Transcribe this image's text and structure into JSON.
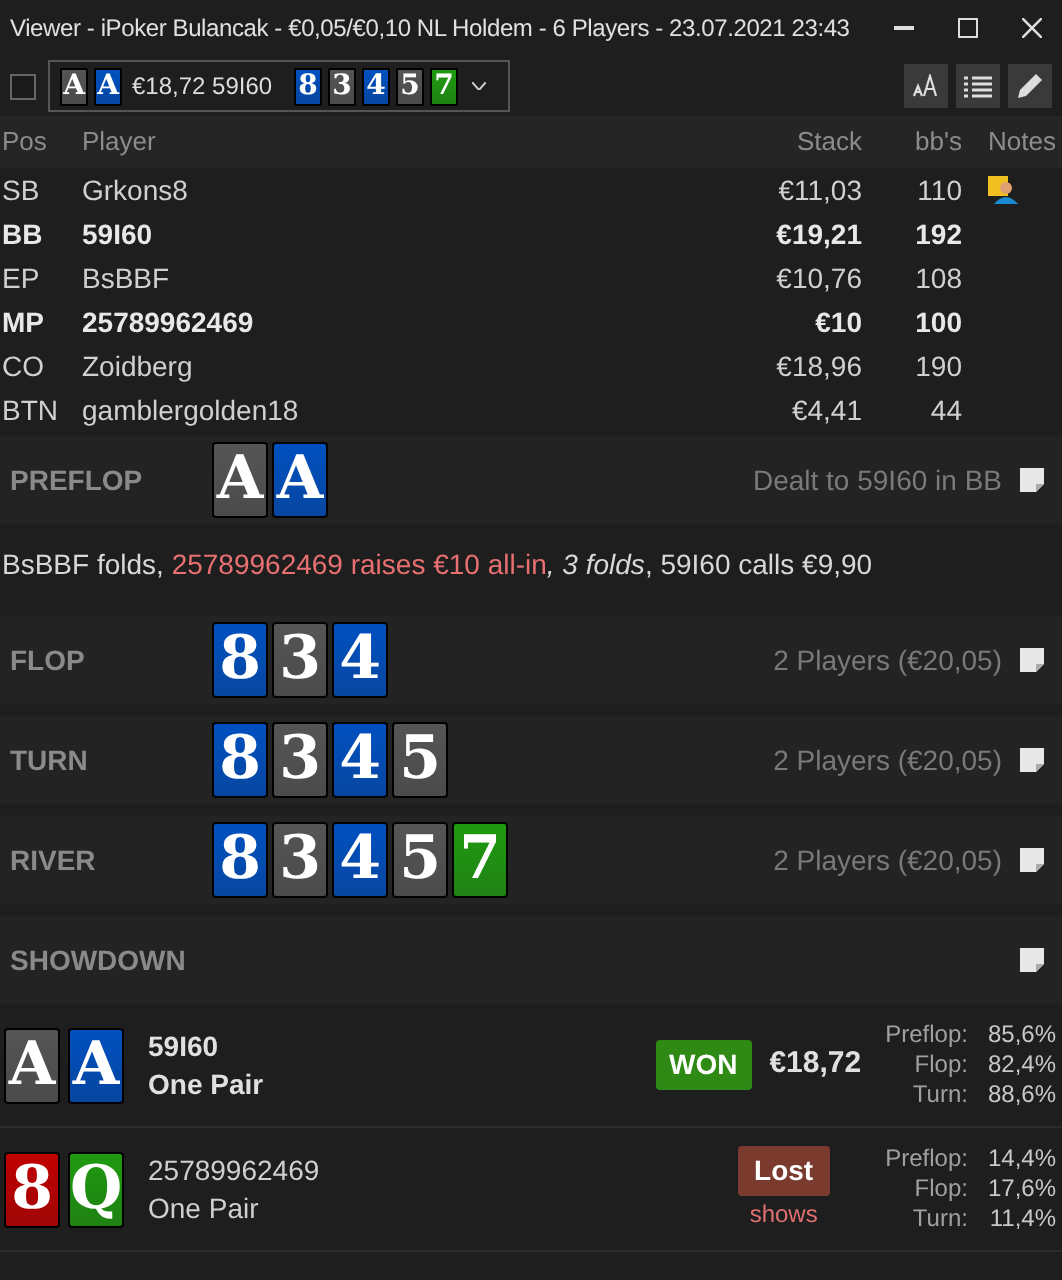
{
  "window": {
    "title": "Viewer - iPoker Bulancak - €0,05/€0,10 NL Holdem - 6 Players - 23.07.2021 23:43"
  },
  "toolbar": {
    "checked": false,
    "hand_selector": {
      "hole_cards": [
        {
          "rank": "A",
          "color": "#555555"
        },
        {
          "rank": "A",
          "color": "#0050c0"
        }
      ],
      "summary": "€18,72 59I60",
      "board": [
        {
          "rank": "8",
          "color": "#0050c0"
        },
        {
          "rank": "3",
          "color": "#555555"
        },
        {
          "rank": "4",
          "color": "#0050c0"
        },
        {
          "rank": "5",
          "color": "#555555"
        },
        {
          "rank": "7",
          "color": "#1f9a10"
        }
      ]
    }
  },
  "table": {
    "columns": [
      "Pos",
      "Player",
      "Stack",
      "bb's",
      "Notes"
    ],
    "rows": [
      {
        "pos": "SB",
        "player": "Grkons8",
        "stack": "€11,03",
        "bbs": "110",
        "bold": false,
        "has_note": true
      },
      {
        "pos": "BB",
        "player": "59I60",
        "stack": "€19,21",
        "bbs": "192",
        "bold": true,
        "has_note": false
      },
      {
        "pos": "EP",
        "player": "BsBBF",
        "stack": "€10,76",
        "bbs": "108",
        "bold": false,
        "has_note": false
      },
      {
        "pos": "MP",
        "player": "25789962469",
        "stack": "€10",
        "bbs": "100",
        "bold": true,
        "has_note": false
      },
      {
        "pos": "CO",
        "player": "Zoidberg",
        "stack": "€18,96",
        "bbs": "190",
        "bold": false,
        "has_note": false
      },
      {
        "pos": "BTN",
        "player": "gamblergolden18",
        "stack": "€4,41",
        "bbs": "44",
        "bold": false,
        "has_note": false
      }
    ]
  },
  "streets": [
    {
      "name": "PREFLOP",
      "cards": [
        {
          "rank": "A",
          "color": "#555555"
        },
        {
          "rank": "A",
          "color": "#0050c0"
        }
      ],
      "info": "Dealt to 59I60 in BB",
      "actions": [
        {
          "kind": "plain",
          "text": "BsBBF folds, "
        },
        {
          "kind": "raise",
          "text": "25789962469 raises €10 all-in"
        },
        {
          "kind": "italic",
          "text": ", 3 folds"
        },
        {
          "kind": "plain",
          "text": ", 59I60 calls €9,90"
        }
      ]
    },
    {
      "name": "FLOP",
      "cards": [
        {
          "rank": "8",
          "color": "#0050c0"
        },
        {
          "rank": "3",
          "color": "#555555"
        },
        {
          "rank": "4",
          "color": "#0050c0"
        }
      ],
      "info": "2 Players (€20,05)"
    },
    {
      "name": "TURN",
      "cards": [
        {
          "rank": "8",
          "color": "#0050c0"
        },
        {
          "rank": "3",
          "color": "#555555"
        },
        {
          "rank": "4",
          "color": "#0050c0"
        },
        {
          "rank": "5",
          "color": "#555555"
        }
      ],
      "info": "2 Players (€20,05)"
    },
    {
      "name": "RIVER",
      "cards": [
        {
          "rank": "8",
          "color": "#0050c0"
        },
        {
          "rank": "3",
          "color": "#555555"
        },
        {
          "rank": "4",
          "color": "#0050c0"
        },
        {
          "rank": "5",
          "color": "#555555"
        },
        {
          "rank": "7",
          "color": "#1f9a10"
        }
      ],
      "info": "2 Players (€20,05)"
    },
    {
      "name": "SHOWDOWN"
    }
  ],
  "showdown": [
    {
      "cards": [
        {
          "rank": "A",
          "color": "#555555"
        },
        {
          "rank": "A",
          "color": "#0050c0"
        }
      ],
      "player": "59I60",
      "hand": "One Pair",
      "bold": true,
      "result": {
        "kind": "won",
        "label": "WON",
        "amount": "€18,72"
      },
      "equity": [
        {
          "label": "Preflop:",
          "value": "85,6%"
        },
        {
          "label": "Flop:",
          "value": "82,4%"
        },
        {
          "label": "Turn:",
          "value": "88,6%"
        }
      ]
    },
    {
      "cards": [
        {
          "rank": "8",
          "color": "#c00000"
        },
        {
          "rank": "Q",
          "color": "#1f9a10"
        }
      ],
      "player": "25789962469",
      "hand": "One Pair",
      "bold": false,
      "result": {
        "kind": "lost",
        "label": "Lost",
        "note": "shows"
      },
      "equity": [
        {
          "label": "Preflop:",
          "value": "14,4%"
        },
        {
          "label": "Flop:",
          "value": "17,6%"
        },
        {
          "label": "Turn:",
          "value": "11,4%"
        }
      ]
    }
  ]
}
